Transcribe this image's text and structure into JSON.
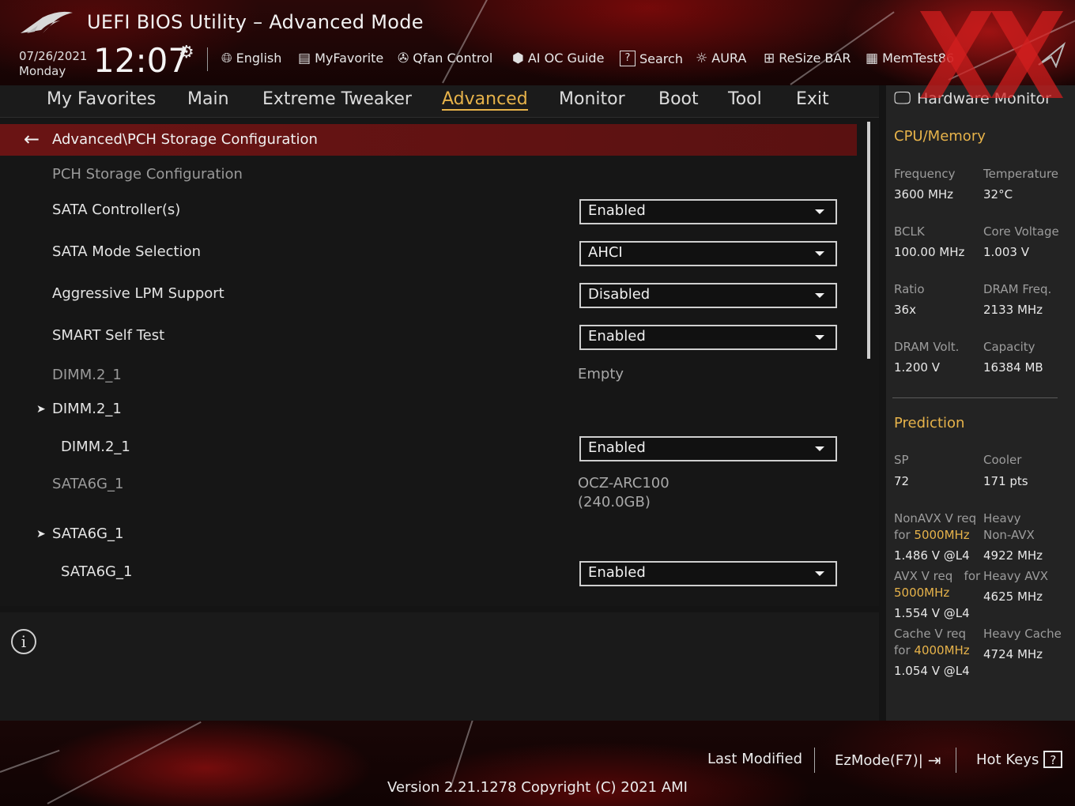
{
  "header": {
    "title": "UEFI BIOS Utility – Advanced Mode",
    "date": "07/26/2021",
    "weekday": "Monday",
    "time": "12:07",
    "toolbar": [
      {
        "label": "English",
        "icon": "globe-icon"
      },
      {
        "label": "MyFavorite",
        "icon": "favorite-icon"
      },
      {
        "label": "Qfan Control",
        "icon": "fan-icon"
      },
      {
        "label": "AI OC Guide",
        "icon": "ai-oc-icon"
      },
      {
        "label": "Search",
        "icon": "search-icon"
      },
      {
        "label": "AURA",
        "icon": "aura-icon"
      },
      {
        "label": "ReSize BAR",
        "icon": "resize-bar-icon"
      },
      {
        "label": "MemTest86",
        "icon": "memtest-icon"
      }
    ]
  },
  "nav": {
    "tabs": [
      "My Favorites",
      "Main",
      "Extreme Tweaker",
      "Advanced",
      "Monitor",
      "Boot",
      "Tool",
      "Exit"
    ],
    "active": "Advanced"
  },
  "main": {
    "breadcrumb": "Advanced\\PCH Storage Configuration",
    "section_title": "PCH Storage Configuration",
    "items": [
      {
        "label": "SATA Controller(s)",
        "value": "Enabled"
      },
      {
        "label": "SATA Mode Selection",
        "value": "AHCI"
      },
      {
        "label": "Aggressive LPM Support",
        "value": "Disabled"
      },
      {
        "label": "SMART Self Test",
        "value": "Enabled"
      },
      {
        "label": "DIMM.2_1",
        "value": "Empty"
      },
      {
        "label": "DIMM.2_1"
      },
      {
        "label": "DIMM.2_1",
        "value": "Enabled"
      },
      {
        "label": "SATA6G_1",
        "value_line1": "OCZ-ARC100",
        "value_line2": "(240.0GB)"
      },
      {
        "label": "SATA6G_1"
      },
      {
        "label": "SATA6G_1",
        "value": "Enabled"
      }
    ]
  },
  "hw": {
    "title": "Hardware Monitor",
    "cpu_memory": {
      "heading": "CPU/Memory",
      "stats": [
        {
          "label": "Frequency",
          "value": "3600 MHz"
        },
        {
          "label": "Temperature",
          "value": "32°C"
        },
        {
          "label": "BCLK",
          "value": "100.00 MHz"
        },
        {
          "label": "Core Voltage",
          "value": "1.003 V"
        },
        {
          "label": "Ratio",
          "value": "36x"
        },
        {
          "label": "DRAM Freq.",
          "value": "2133 MHz"
        },
        {
          "label": "DRAM Volt.",
          "value": "1.200 V"
        },
        {
          "label": "Capacity",
          "value": "16384 MB"
        }
      ]
    },
    "prediction": {
      "heading": "Prediction",
      "sp_label": "SP",
      "sp_value": "72",
      "cooler_label": "Cooler",
      "cooler_value": "171 pts",
      "nonavx_label_1": "NonAVX V req",
      "nonavx_label_2": "for",
      "nonavx_freq": "5000MHz",
      "nonavx_value": "1.486 V @L4",
      "heavy_nonavx_label_1": "Heavy",
      "heavy_nonavx_label_2": "Non-AVX",
      "heavy_nonavx_value": "4922 MHz",
      "avx_label_1": "AVX V req",
      "avx_label_2": "for",
      "avx_freq": "5000MHz",
      "avx_value": "1.554 V @L4",
      "heavy_avx_label": "Heavy AVX",
      "heavy_avx_value": "4625 MHz",
      "cache_label_1": "Cache V req",
      "cache_label_2": "for",
      "cache_freq": "4000MHz",
      "cache_value": "1.054 V @L4",
      "heavy_cache_label": "Heavy Cache",
      "heavy_cache_value": "4724 MHz"
    }
  },
  "footer": {
    "last_modified": "Last Modified",
    "ezmode": "EzMode(F7)|",
    "hot_keys": "Hot Keys",
    "hot_keys_icon": "?",
    "version": "Version 2.21.1278 Copyright (C) 2021 AMI"
  },
  "colors": {
    "accent": "#e7b34a",
    "breadcrumb_bar": "#6a1414",
    "panel": "#161616",
    "hw_panel": "#232323"
  }
}
